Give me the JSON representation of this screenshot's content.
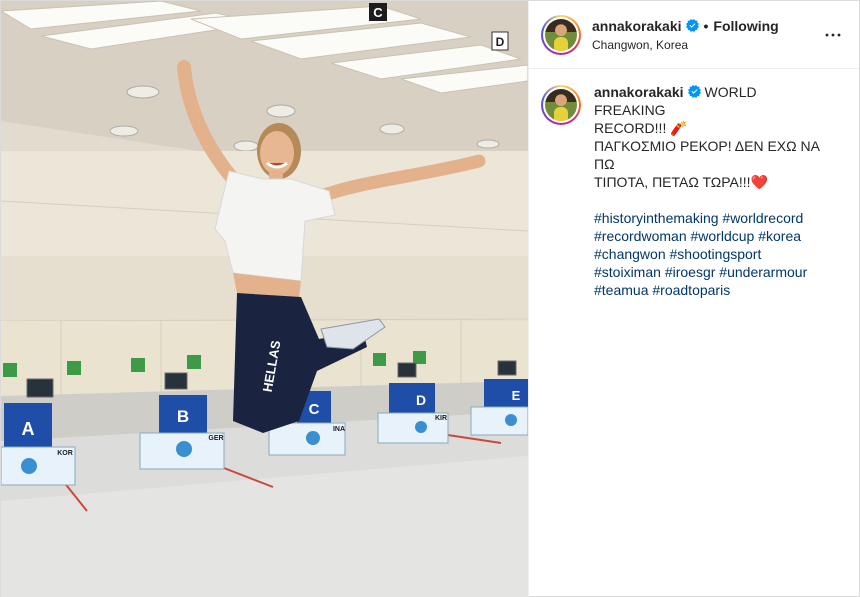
{
  "post": {
    "author": {
      "username": "annakorakaki",
      "verified": true,
      "follow_status": "Following",
      "location": "Changwon, Korea"
    },
    "caption": {
      "lines": [
        "WORLD FREAKING",
        "RECORD!!!",
        "ΠΑΓΚΟΣΜΙΟ ΡΕΚΟΡ! ΔΕΝ ΕΧΩ ΝΑ ΠΩ",
        "ΤΙΠΟΤΑ, ΠΕΤΑΩ ΤΩΡΑ!!!"
      ],
      "emoji_after_record": "🧨",
      "emoji_end": "❤️",
      "hashtags": [
        "#historyinthemaking",
        "#worldrecord",
        "#recordwoman",
        "#worldcup",
        "#korea",
        "#changwon",
        "#shootingsport",
        "#stoiximan",
        "#iroesgr",
        "#underarmour",
        "#teamua",
        "#roadtoparis"
      ]
    },
    "photo": {
      "signs": [
        "A",
        "B",
        "C",
        "D",
        "E"
      ],
      "ceiling_signs": [
        "C",
        "D"
      ],
      "shirt_text": "HELLAS",
      "country_codes": [
        "KOR",
        "GER",
        "INA",
        "KIR"
      ],
      "colors": {
        "ceiling": "#d9d3c6",
        "wall": "#e9e2d2",
        "floor": "#dcdcdc",
        "stand_blue": "#1e4ea8",
        "pants": "#1a2340",
        "tshirt": "#f4f4f2"
      }
    }
  },
  "ui": {
    "more_icon": "more-horizontal-icon",
    "verified_icon": "verified-badge-icon",
    "accent_link": "#00376b",
    "verified_color": "#0095f6"
  }
}
